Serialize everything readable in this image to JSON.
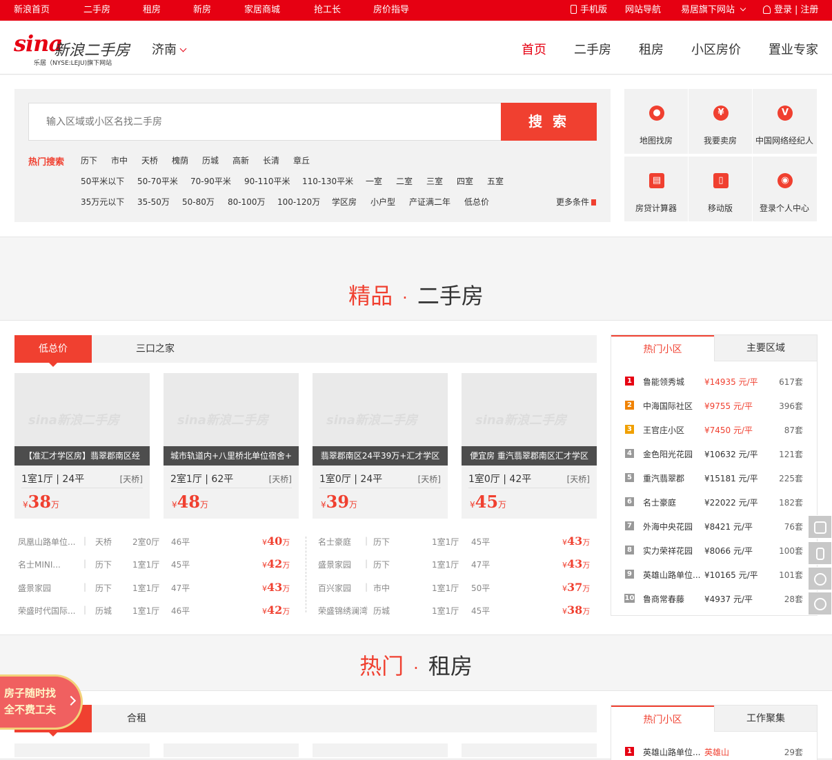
{
  "topbar": {
    "left_links": [
      "新浪首页",
      "二手房",
      "租房",
      "新房",
      "家居商城",
      "抢工长",
      "房价指导"
    ],
    "mobile": "手机版",
    "nav_map": "网站导航",
    "family": "易居旗下网站",
    "login": "登录",
    "register": "注册"
  },
  "header": {
    "logo_sina": "sina",
    "logo_name": "新浪二手房",
    "logo_sub": "乐居（NYSE:LEJU)旗下网站",
    "city": "济南",
    "nav": [
      "首页",
      "二手房",
      "租房",
      "小区房价",
      "置业专家"
    ]
  },
  "search": {
    "placeholder": "输入区域或小区名找二手房",
    "button": "搜 索",
    "hot_label": "热门搜索",
    "areas": [
      "历下",
      "市中",
      "天桥",
      "槐荫",
      "历城",
      "高新",
      "长清",
      "章丘"
    ],
    "sizes": [
      "50平米以下",
      "50-70平米",
      "70-90平米",
      "90-110平米",
      "110-130平米",
      "一室",
      "二室",
      "三室",
      "四室",
      "五室"
    ],
    "prices": [
      "35万元以下",
      "35-50万",
      "50-80万",
      "80-100万",
      "100-120万",
      "学区房",
      "小户型",
      "产证满二年",
      "低总价"
    ],
    "more": "更多条件"
  },
  "services": [
    {
      "label": "地图找房",
      "icon": "map-pin-icon",
      "glyph": "●"
    },
    {
      "label": "我要卖房",
      "icon": "house-yuan-icon",
      "glyph": "¥"
    },
    {
      "label": "中国网络经纪人",
      "icon": "agent-icon",
      "glyph": "V"
    },
    {
      "label": "房贷计算器",
      "icon": "calculator-icon",
      "glyph": "▤"
    },
    {
      "label": "移动版",
      "icon": "mobile-icon",
      "glyph": "▯"
    },
    {
      "label": "登录个人中心",
      "icon": "user-icon",
      "glyph": "◉"
    }
  ],
  "section1": {
    "title_red": "精品",
    "dot": "·",
    "title_dark": "二手房",
    "tabs": [
      "低总价",
      "三口之家"
    ],
    "watermark": "sina新浪二手房",
    "cards": [
      {
        "caption": "【准汇才学区房】翡翠郡南区经",
        "layout": "1室1厅 | 24平",
        "area": "[天桥]",
        "yen": "¥",
        "price": "38",
        "unit": "万"
      },
      {
        "caption": "城市轨道内+八里桥北单位宿舍+",
        "layout": "2室1厅 | 62平",
        "area": "[天桥]",
        "yen": "¥",
        "price": "48",
        "unit": "万"
      },
      {
        "caption": "翡翠郡南区24平39万+汇才学区",
        "layout": "1室0厅 | 24平",
        "area": "[天桥]",
        "yen": "¥",
        "price": "39",
        "unit": "万"
      },
      {
        "caption": "便宜房 重汽翡翠郡南区汇才学区",
        "layout": "1室0厅 | 42平",
        "area": "[天桥]",
        "yen": "¥",
        "price": "45",
        "unit": "万"
      }
    ],
    "list_left": [
      {
        "name": "凤凰山路单位...",
        "sep": "|",
        "area": "天桥",
        "layout": "2室0厅",
        "size": "46平",
        "price": "40"
      },
      {
        "name": "名士MINI...",
        "sep": "|",
        "area": "历下",
        "layout": "1室1厅",
        "size": "45平",
        "price": "42"
      },
      {
        "name": "盛景家园",
        "sep": "|",
        "area": "历下",
        "layout": "1室1厅",
        "size": "47平",
        "price": "43"
      },
      {
        "name": "荣盛时代国际...",
        "sep": "|",
        "area": "历城",
        "layout": "1室1厅",
        "size": "46平",
        "price": "42"
      }
    ],
    "list_right": [
      {
        "name": "名士豪庭",
        "sep": "|",
        "area": "历下",
        "layout": "1室1厅",
        "size": "45平",
        "price": "43"
      },
      {
        "name": "盛景家园",
        "sep": "|",
        "area": "历下",
        "layout": "1室1厅",
        "size": "47平",
        "price": "43"
      },
      {
        "name": "百兴家园",
        "sep": "|",
        "area": "市中",
        "layout": "1室1厅",
        "size": "50平",
        "price": "37"
      },
      {
        "name": "荣盛锦绣澜湾",
        "sep": "|",
        "area": "历城",
        "layout": "1室1厅",
        "size": "45平",
        "price": "38"
      }
    ],
    "side_tabs": [
      "热门小区",
      "主要区域"
    ],
    "ranking": [
      {
        "rank": "1",
        "name": "鲁能领秀城",
        "price": "¥14935 元/平",
        "count": "617套"
      },
      {
        "rank": "2",
        "name": "中海国际社区",
        "price": "¥9755 元/平",
        "count": "396套"
      },
      {
        "rank": "3",
        "name": "王官庄小区",
        "price": "¥7450 元/平",
        "count": "87套"
      },
      {
        "rank": "4",
        "name": "金色阳光花园",
        "price": "¥10632 元/平",
        "count": "121套"
      },
      {
        "rank": "5",
        "name": "重汽翡翠郡",
        "price": "¥15181 元/平",
        "count": "225套"
      },
      {
        "rank": "6",
        "name": "名士豪庭",
        "price": "¥22022 元/平",
        "count": "182套"
      },
      {
        "rank": "7",
        "name": "外海中央花园",
        "price": "¥8421 元/平",
        "count": "76套"
      },
      {
        "rank": "8",
        "name": "实力荣祥花园",
        "price": "¥8066 元/平",
        "count": "100套"
      },
      {
        "rank": "9",
        "name": "英雄山路单位...",
        "price": "¥10165 元/平",
        "count": "101套"
      },
      {
        "rank": "10",
        "name": "鲁商常春藤",
        "price": "¥4937 元/平",
        "count": "28套"
      }
    ],
    "rank_colors": [
      "#e60012",
      "#f08200",
      "#f0a000",
      "#999999"
    ]
  },
  "section2": {
    "title_red": "热门",
    "dot": "·",
    "title_dark": "租房",
    "tab2": "合租",
    "side_tabs": [
      "热门小区",
      "工作聚集"
    ],
    "first_rank": {
      "rank": "1",
      "name": "英雄山路单位...",
      "area": "英雄山",
      "count": "29套"
    }
  },
  "promo": {
    "line1": "房子随时找",
    "line2": "全不费工夫"
  }
}
